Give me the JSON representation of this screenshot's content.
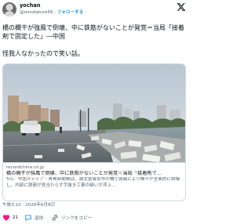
{
  "author": {
    "display_name": "yochan",
    "handle": "@nondakure56",
    "follow_label": "フォローする"
  },
  "tweet": {
    "headline": "橋の欄干が強風で倒壊、中に鉄筋がないことが発覚＝当局「接着剤で固定した」―中国",
    "comment": "怪我人なかったので笑い話。"
  },
  "card": {
    "domain": "recordchina.co.jp",
    "title": "橋の欄干が強風で倒壊、中に鉄筋がないことが発覚＝当局「接着剤で…",
    "description": "5日、中国メディア・青島新聞網は、湖北省咸寧市の橋で強風により欄干が全面的に倒壊し、内部に鉄筋が見当たらず手抜き工事の疑いが浮上…"
  },
  "meta": {
    "timestamp": "午後3:10 · 2026年6月8日"
  },
  "actions": {
    "like_count": "21",
    "reply_label": "返信",
    "copy_link_label": "リンクをコピー"
  },
  "icons": {
    "logo": "x-logo-icon",
    "like": "heart-icon",
    "reply": "speech-bubble-icon",
    "copy_link": "link-icon"
  },
  "colors": {
    "accent": "#1d9bf0",
    "like": "#f91880"
  }
}
